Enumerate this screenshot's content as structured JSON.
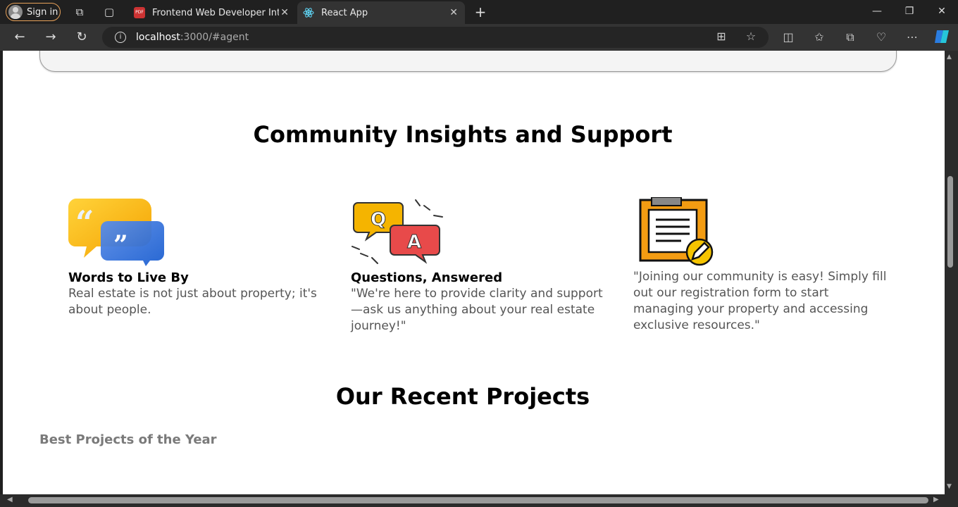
{
  "browser": {
    "signin_label": "Sign in",
    "tabs": [
      {
        "title": "Frontend Web Developer Internsh",
        "favicon": "pdf-icon"
      },
      {
        "title": "React App",
        "favicon": "react-icon"
      }
    ],
    "url_host": "localhost",
    "url_path": ":3000/#agent"
  },
  "page": {
    "insights_title": "Community Insights and Support",
    "cards": [
      {
        "icon": "quote-bubbles-icon",
        "title": "Words to Live By",
        "text": "Real estate is not just about property; it's about people."
      },
      {
        "icon": "qa-bubbles-icon",
        "title": "Questions, Answered",
        "text": "\"We're here to provide clarity and support—ask us anything about your real estate journey!\""
      },
      {
        "icon": "clipboard-edit-icon",
        "title": "",
        "text": "\"Joining our community is easy! Simply fill out our registration form to start managing your property and accessing exclusive resources.\""
      }
    ],
    "projects_title": "Our Recent Projects",
    "projects_subtitle": "Best Projects of the Year"
  },
  "colors": {
    "accent_orange": "#f5a000",
    "bubble_red": "#e84a4a",
    "bubble_blue": "#2a7de1"
  }
}
